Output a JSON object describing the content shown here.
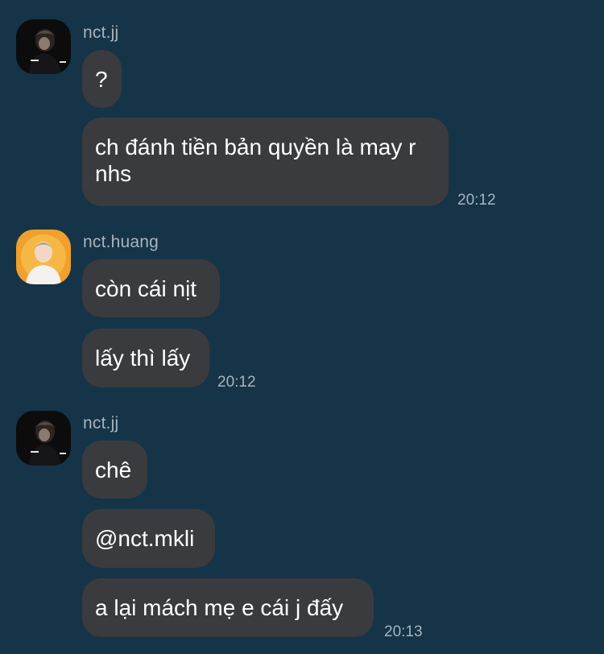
{
  "messages": [
    {
      "user": "nct.jj",
      "bubbles": [
        "?",
        "ch đánh tiền bản quyền là may r nhs"
      ],
      "time": "20:12"
    },
    {
      "user": "nct.huang",
      "bubbles": [
        "còn cái nịt",
        "lấy thì lấy"
      ],
      "time": "20:12"
    },
    {
      "user": "nct.jj",
      "bubbles": [
        "chê",
        "@nct.mkli",
        "a lại mách mẹ e cái j đấy"
      ],
      "time": "20:13"
    }
  ],
  "colors": {
    "background": "#153448",
    "bubble": "#3a3b3e",
    "meta_text": "#a8b3bd"
  }
}
